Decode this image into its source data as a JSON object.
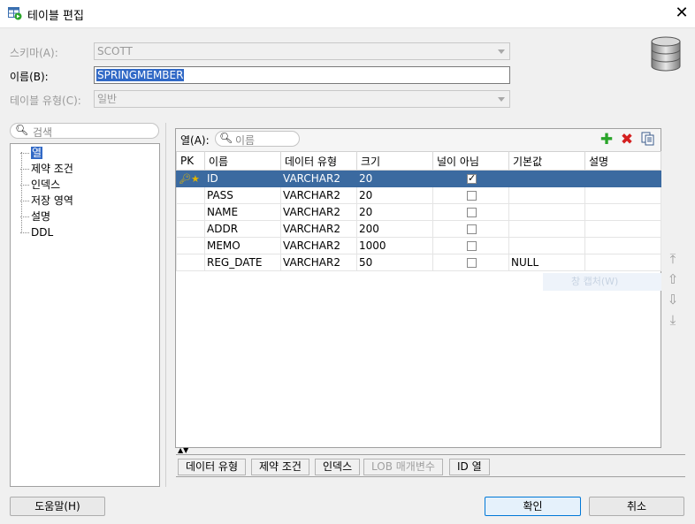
{
  "window": {
    "title": "테이블 편집"
  },
  "form": {
    "schema_label": "스키마(A):",
    "schema_value": "SCOTT",
    "name_label": "이름(B):",
    "name_value": "SPRINGMEMBER",
    "type_label": "테이블 유형(C):",
    "type_value": "일반"
  },
  "left": {
    "search_placeholder": "검색",
    "items": [
      "열",
      "제약 조건",
      "인덱스",
      "저장 영역",
      "설명",
      "DDL"
    ]
  },
  "columns_panel": {
    "label": "열(A):",
    "search_placeholder": "이름",
    "headers": [
      "PK",
      "이름",
      "데이터 유형",
      "크기",
      "널이 아님",
      "기본값",
      "설명"
    ],
    "rows": [
      {
        "pk": true,
        "name": "ID",
        "type": "VARCHAR2",
        "size": "20",
        "not_null": true,
        "default": "",
        "desc": ""
      },
      {
        "pk": false,
        "name": "PASS",
        "type": "VARCHAR2",
        "size": "20",
        "not_null": false,
        "default": "",
        "desc": ""
      },
      {
        "pk": false,
        "name": "NAME",
        "type": "VARCHAR2",
        "size": "20",
        "not_null": false,
        "default": "",
        "desc": ""
      },
      {
        "pk": false,
        "name": "ADDR",
        "type": "VARCHAR2",
        "size": "200",
        "not_null": false,
        "default": "",
        "desc": ""
      },
      {
        "pk": false,
        "name": "MEMO",
        "type": "VARCHAR2",
        "size": "1000",
        "not_null": false,
        "default": "",
        "desc": ""
      },
      {
        "pk": false,
        "name": "REG_DATE",
        "type": "VARCHAR2",
        "size": "50",
        "not_null": false,
        "default": "NULL",
        "desc": ""
      }
    ],
    "ghost_text": "창 캡처(W)"
  },
  "tabs": [
    "데이터 유형",
    "제약 조건",
    "인덱스",
    "LOB 매개변수",
    "ID 열"
  ],
  "buttons": {
    "help": "도움말(H)",
    "ok": "확인",
    "cancel": "취소"
  },
  "colors": {
    "selection": "#3b6aa0",
    "add": "#2aa52a",
    "delete": "#d42020"
  }
}
